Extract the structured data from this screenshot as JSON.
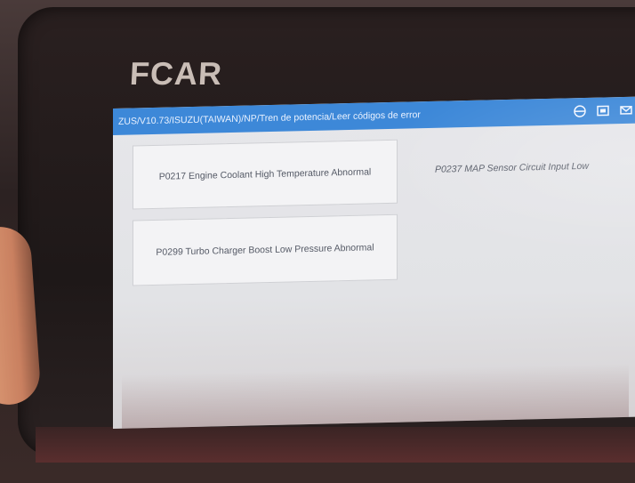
{
  "device": {
    "brand": "FCAR"
  },
  "title_bar": {
    "breadcrumb": "ZUS/V10.73/ISUZU(TAIWAN)/NP/Tren de potencia/Leer códigos de error",
    "icons": [
      "globe-icon",
      "screenshot-icon",
      "mail-icon"
    ]
  },
  "codes": [
    {
      "text": "P0217 Engine Coolant High Temperature Abnormal"
    },
    {
      "text": "P0237 MAP Sensor Circuit Input Low"
    },
    {
      "text": "P0299 Turbo Charger Boost Low Pressure Abnormal"
    }
  ],
  "colors": {
    "title_bar": "#3d88d8",
    "screen_bg": "#e6e6ea",
    "card_bg": "#f3f3f5",
    "bezel": "#1e1818"
  }
}
